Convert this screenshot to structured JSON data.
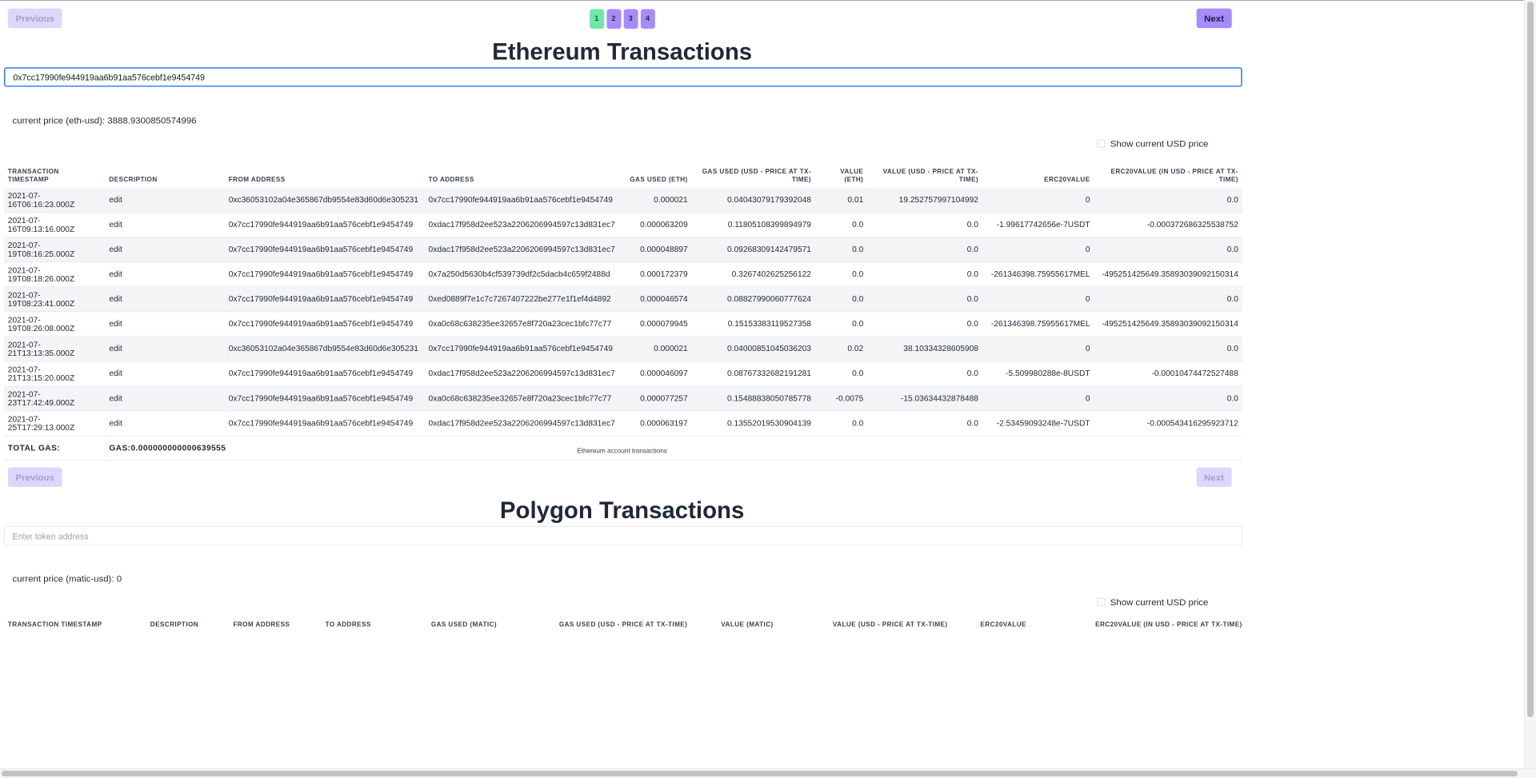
{
  "pagination": {
    "previous_label": "Previous",
    "next_label": "Next",
    "pages": [
      "1",
      "2",
      "3",
      "4"
    ],
    "active_page": "1"
  },
  "ethereum": {
    "title": "Ethereum Transactions",
    "search_value": "0x7cc17990fe944919aa6b91aa576cebf1e9454749",
    "current_price": "current price (eth-usd): 3888.9300850574996",
    "show_usd_label": "Show current USD price",
    "columns": [
      "TRANSACTION TIMESTAMP",
      "DESCRIPTION",
      "FROM ADDRESS",
      "TO ADDRESS",
      "GAS USED (ETH)",
      "GAS USED (USD - PRICE AT TX-TIME)",
      "VALUE (ETH)",
      "VALUE (USD - PRICE AT TX-TIME)",
      "ERC20VALUE",
      "ERC20VALUE (IN USD - PRICE AT TX-TIME)"
    ],
    "rows": [
      {
        "ts": "2021-07-16T06:16:23.000Z",
        "desc": "edit",
        "from": "0xc36053102a04e365867db9554e83d60d6e305231",
        "to": "0x7cc17990fe944919aa6b91aa576cebf1e9454749",
        "gas_eth": "0.000021",
        "gas_usd": "0.04043079179392048",
        "val_eth": "0.01",
        "val_usd": "19.252757997104992",
        "erc": "0",
        "erc_usd": "0.0"
      },
      {
        "ts": "2021-07-16T09:13:16.000Z",
        "desc": "edit",
        "from": "0x7cc17990fe944919aa6b91aa576cebf1e9454749",
        "to": "0xdac17f958d2ee523a2206206994597c13d831ec7",
        "gas_eth": "0.000063209",
        "gas_usd": "0.11805108399894979",
        "val_eth": "0.0",
        "val_usd": "0.0",
        "erc": "-1.99617742656e-7USDT",
        "erc_usd": "-0.000372686325538752"
      },
      {
        "ts": "2021-07-19T08:16:25.000Z",
        "desc": "edit",
        "from": "0x7cc17990fe944919aa6b91aa576cebf1e9454749",
        "to": "0xdac17f958d2ee523a2206206994597c13d831ec7",
        "gas_eth": "0.000048897",
        "gas_usd": "0.09268309142479571",
        "val_eth": "0.0",
        "val_usd": "0.0",
        "erc": "0",
        "erc_usd": "0.0"
      },
      {
        "ts": "2021-07-19T08:18:26.000Z",
        "desc": "edit",
        "from": "0x7cc17990fe944919aa6b91aa576cebf1e9454749",
        "to": "0x7a250d5630b4cf539739df2c5dacb4c659f2488d",
        "gas_eth": "0.000172379",
        "gas_usd": "0.3267402625256122",
        "val_eth": "0.0",
        "val_usd": "0.0",
        "erc": "-261346398.75955617MEL",
        "erc_usd": "-495251425649.35893039092150314"
      },
      {
        "ts": "2021-07-19T08:23:41.000Z",
        "desc": "edit",
        "from": "0x7cc17990fe944919aa6b91aa576cebf1e9454749",
        "to": "0xed0889f7e1c7c7267407222be277e1f1ef4d4892",
        "gas_eth": "0.000046574",
        "gas_usd": "0.08827990060777624",
        "val_eth": "0.0",
        "val_usd": "0.0",
        "erc": "0",
        "erc_usd": "0.0"
      },
      {
        "ts": "2021-07-19T08:26:08.000Z",
        "desc": "edit",
        "from": "0x7cc17990fe944919aa6b91aa576cebf1e9454749",
        "to": "0xa0c68c638235ee32657e8f720a23cec1bfc77c77",
        "gas_eth": "0.000079945",
        "gas_usd": "0.15153383119527358",
        "val_eth": "0.0",
        "val_usd": "0.0",
        "erc": "-261346398.75955617MEL",
        "erc_usd": "-495251425649.35893039092150314"
      },
      {
        "ts": "2021-07-21T13:13:35.000Z",
        "desc": "edit",
        "from": "0xc36053102a04e365867db9554e83d60d6e305231",
        "to": "0x7cc17990fe944919aa6b91aa576cebf1e9454749",
        "gas_eth": "0.000021",
        "gas_usd": "0.04000851045036203",
        "val_eth": "0.02",
        "val_usd": "38.10334328605908",
        "erc": "0",
        "erc_usd": "0.0"
      },
      {
        "ts": "2021-07-21T13:15:20.000Z",
        "desc": "edit",
        "from": "0x7cc17990fe944919aa6b91aa576cebf1e9454749",
        "to": "0xdac17f958d2ee523a2206206994597c13d831ec7",
        "gas_eth": "0.000046097",
        "gas_usd": "0.08767332682191281",
        "val_eth": "0.0",
        "val_usd": "0.0",
        "erc": "-5.509980288e-8USDT",
        "erc_usd": "-0.00010474472527488"
      },
      {
        "ts": "2021-07-23T17:42:49.000Z",
        "desc": "edit",
        "from": "0x7cc17990fe944919aa6b91aa576cebf1e9454749",
        "to": "0xa0c68c638235ee32657e8f720a23cec1bfc77c77",
        "gas_eth": "0.000077257",
        "gas_usd": "0.15488838050785778",
        "val_eth": "-0.0075",
        "val_usd": "-15.03634432878488",
        "erc": "0",
        "erc_usd": "0.0"
      },
      {
        "ts": "2021-07-25T17:29:13.000Z",
        "desc": "edit",
        "from": "0x7cc17990fe944919aa6b91aa576cebf1e9454749",
        "to": "0xdac17f958d2ee523a2206206994597c13d831ec7",
        "gas_eth": "0.000063197",
        "gas_usd": "0.13552019530904139",
        "val_eth": "0.0",
        "val_usd": "0.0",
        "erc": "-2.53459093248e-7USDT",
        "erc_usd": "-0.000543416295923712"
      }
    ],
    "total_label": "TOTAL GAS:",
    "total_value": "GAS:0.000000000000639555",
    "caption": "Ethereum account transactions"
  },
  "polygon": {
    "previous_label": "Previous",
    "next_label": "Next",
    "title": "Polygon Transactions",
    "search_placeholder": "Enter token address",
    "current_price": "current price (matic-usd): 0",
    "show_usd_label": "Show current USD price",
    "columns": [
      "TRANSACTION TIMESTAMP",
      "DESCRIPTION",
      "FROM ADDRESS",
      "TO ADDRESS",
      "GAS USED (MATIC)",
      "GAS USED (USD - PRICE AT TX-TIME)",
      "VALUE (MATIC)",
      "VALUE (USD - PRICE AT TX-TIME)",
      "ERC20VALUE",
      "ERC20VALUE (IN USD - PRICE AT TX-TIME)"
    ]
  },
  "colors": {
    "button_enabled": "#a78bfa",
    "button_disabled": "#ddd6fe",
    "page_active": "#6ee7a7",
    "focus_border": "#3b82f6",
    "row_stripe": "#f3f4f6"
  }
}
